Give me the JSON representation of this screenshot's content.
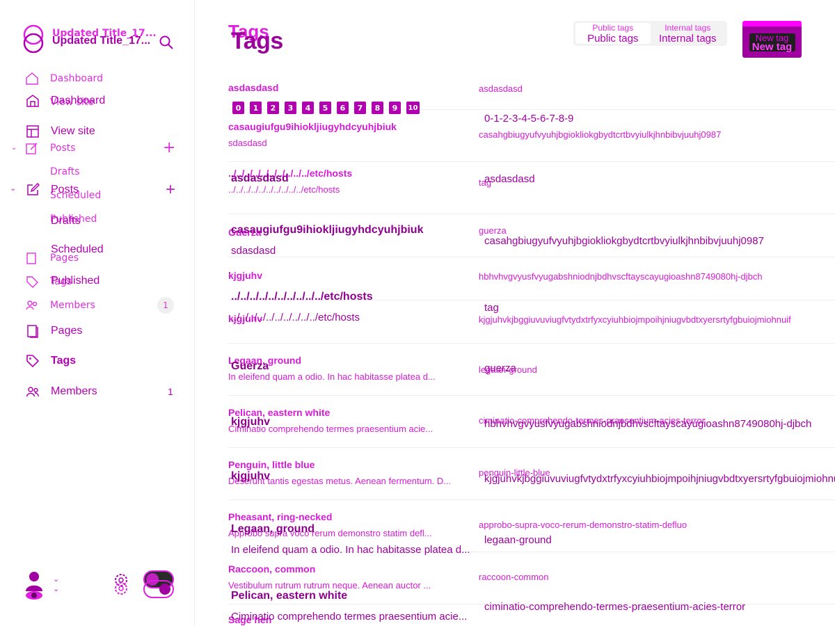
{
  "brand": {
    "title": "Updated Title_17...",
    "title_ghost": "Updated Title_17..."
  },
  "sidebar": {
    "ghost_items": [
      "Dashboard",
      "View site",
      "Posts",
      "Drafts",
      "Scheduled",
      "Published",
      "Pages",
      "Tags",
      "Members"
    ],
    "ghost_members_count": "1",
    "items": [
      {
        "label": "Dashboard",
        "icon": "dashboard-icon"
      },
      {
        "label": "View site",
        "icon": "view-site-icon"
      },
      {
        "label": "Posts",
        "icon": "posts-icon",
        "action": "+"
      },
      {
        "label": "Drafts"
      },
      {
        "label": "Scheduled"
      },
      {
        "label": "Published"
      },
      {
        "label": "Pages",
        "icon": "pages-icon"
      },
      {
        "label": "Tags",
        "icon": "tags-icon",
        "active": true
      },
      {
        "label": "Members",
        "icon": "members-icon",
        "count": "1"
      }
    ]
  },
  "header": {
    "title": "Tags",
    "title_ghost": "Tags",
    "tabs": [
      {
        "label": "Public tags",
        "active": true
      },
      {
        "label": "Internal tags",
        "active": false
      }
    ],
    "new_button": "New tag"
  },
  "badges": [
    "0",
    "1",
    "2",
    "3",
    "4",
    "5",
    "6",
    "7",
    "8",
    "9",
    "10"
  ],
  "ghost_rows": [
    {
      "name": "asdasdasd",
      "desc": "",
      "slug": "asdasdasd"
    },
    {
      "name": "casaugiufgu9ihiokljiugyhdcyuhjbiuk",
      "desc": "sdasdasd",
      "slug": "casahgbiugyufvyuhjbgiokliokgbydtcrtbvyiulkjhnbibvjuuhj0987"
    },
    {
      "name": "../../../../../../../../../../etc/hosts",
      "desc": "../../../../../../../../../../etc/hosts",
      "slug": "tag"
    },
    {
      "name": "Guerza",
      "desc": "",
      "slug": "guerza"
    },
    {
      "name": "kjgjuhv",
      "desc": "",
      "slug": "hbhvhvgvyusfvyugabshniodnjbdhvscftayscayugioashn8749080hj-djbch"
    },
    {
      "name": "kjgjuhv",
      "desc": "",
      "slug": "kjgjuhvkjbggiuvuviugfvtydxtrfyxcyiuhbiojmpoihjniugvbdtxyersrtyfgbuiojmiohnuif"
    },
    {
      "name": "Legaan, ground",
      "desc": "In eleifend quam a odio. In hac habitasse platea d...",
      "slug": "legaan-ground"
    },
    {
      "name": "Pelican, eastern white",
      "desc": "Ciminatio comprehendo termes praesentium acie...",
      "slug": "ciminatio-comprehendo-termes-praesentium-acies-terror"
    },
    {
      "name": "Penguin, little blue",
      "desc": "Deserunt tantis egestas metus. Aenean fermentum. D...",
      "slug": "penguin-little-blue"
    },
    {
      "name": "Pheasant, ring-necked",
      "desc": "Approbo supra voco rerum demonstro statim defl...",
      "slug": "approbo-supra-voco-rerum-demonstro-statim-defluo"
    },
    {
      "name": "Raccoon, common",
      "desc": "Vestibulum rutrum rutrum neque. Aenean auctor ...",
      "slug": "raccoon-common"
    },
    {
      "name": "Sage hen",
      "desc": "",
      "slug": ""
    }
  ],
  "overlay": {
    "badges_label": "0-1-2-3-4-5-6-7-8-9",
    "rows": [
      {
        "name": "asdasdasd",
        "slug": "asdasdasd"
      },
      {
        "name": "casaugiufgu9ihiokljiugyhdcyuhjbiuk",
        "desc": "sdasdasd",
        "slug": "casahgbiugyufvyuhjbgiokliokgbydtcrtbvyiulkjhnbibvjuuhj0987"
      },
      {
        "name": "../../../../../../../../../../etc/hosts",
        "desc": "../../../../../../../../../../etc/hosts",
        "slug": "tag"
      },
      {
        "name": "Guerza",
        "slug": "guerza"
      },
      {
        "name": "kjgjuhv",
        "slug": "hbhvhvgvyusfvyugabshniodnjbdhvscftayscayugioashn8749080hj-djbch"
      },
      {
        "name": "kjgjuhv",
        "slug": "kjgjuhvkjbggiuvuviugfvtydxtrfyxcyiuhbiojmpoihjniugvbdtxyersrtyfgbuiojmiohnuif"
      },
      {
        "name": "Legaan, ground",
        "desc": "In eleifend quam a odio. In hac habitasse platea d...",
        "slug": "legaan-ground"
      },
      {
        "name": "Pelican, eastern white",
        "desc": "Ciminatio comprehendo termes praesentium acie...",
        "slug": "ciminatio-comprehendo-termes-praesentium-acies-terror"
      }
    ]
  }
}
